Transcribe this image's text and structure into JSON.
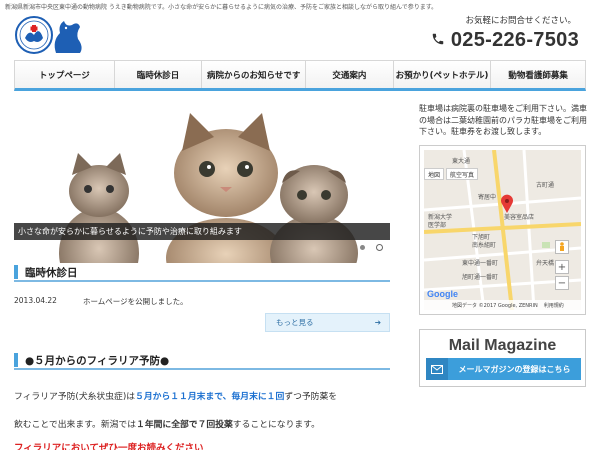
{
  "header": {
    "tagline": "新潟県新潟市中央区東中通の動物病院 うえき動物病院です。小さな命が安らかに暮らせるように病気の治療、予防をご家族と相談しながら取り組んで参ります。",
    "logo_alt": "うえき動物病院",
    "contact_label": "お気軽にお問合せください。",
    "phone": "025-226-7503"
  },
  "nav": {
    "items": [
      "トップページ",
      "臨時休診日",
      "病院からのお知らせです",
      "交通案内",
      "お預かり(ペットホテル)",
      "動物看護師募集"
    ]
  },
  "hero": {
    "caption": "小さな命が安らかに暮らせるように予防や治療に取り組みます",
    "slides_total": 3,
    "active_slide": 2
  },
  "closure": {
    "heading": "臨時休診日",
    "news_date": "2013.04.22",
    "news_text": "ホームページを公開しました。",
    "more_label": "もっと見る",
    "more_arrow": "➔"
  },
  "filaria": {
    "heading": "●５月からのフィラリア予防●",
    "line1_prefix": "フィラリア予防(犬糸状虫症)は",
    "line1_highlight": "５月から１１月末まで、毎月末に１回",
    "line1_suffix": "ずつ予防薬を",
    "line2_prefix": "飲むことで出来ます。新潟では",
    "line2_bold": "１年間に全部で７回投薬",
    "line2_suffix": "することになります。",
    "line3": "フィラリアにおいてぜひ一度お読みください"
  },
  "sidebar": {
    "parking_notice": "駐車場は病院裏の駐車場をご利用下さい。満車の場合は二葉幼稚園前のパラカ駐車場をご利用下さい。駐車券をお渡し致します。",
    "map": {
      "tab_map": "地図",
      "tab_satellite": "航空写真",
      "google": "Google",
      "attribution": "地図データ ©2017 Google, ZENRIN",
      "terms": "利用規約",
      "labels": [
        "東大通",
        "寄居中",
        "新潟大学",
        "医学部",
        "美容室品店",
        "下旭町",
        "南糸組町",
        "東中通一番町",
        "旭町通一番町",
        "古町通",
        "弁天橋"
      ]
    },
    "mail": {
      "title": "Mail Magazine",
      "button_label": "メールマガジンの登録はこちら"
    }
  },
  "colors": {
    "accent": "#4aa3dd",
    "highlight_blue": "#1a6fd0",
    "red": "#dd2222"
  }
}
